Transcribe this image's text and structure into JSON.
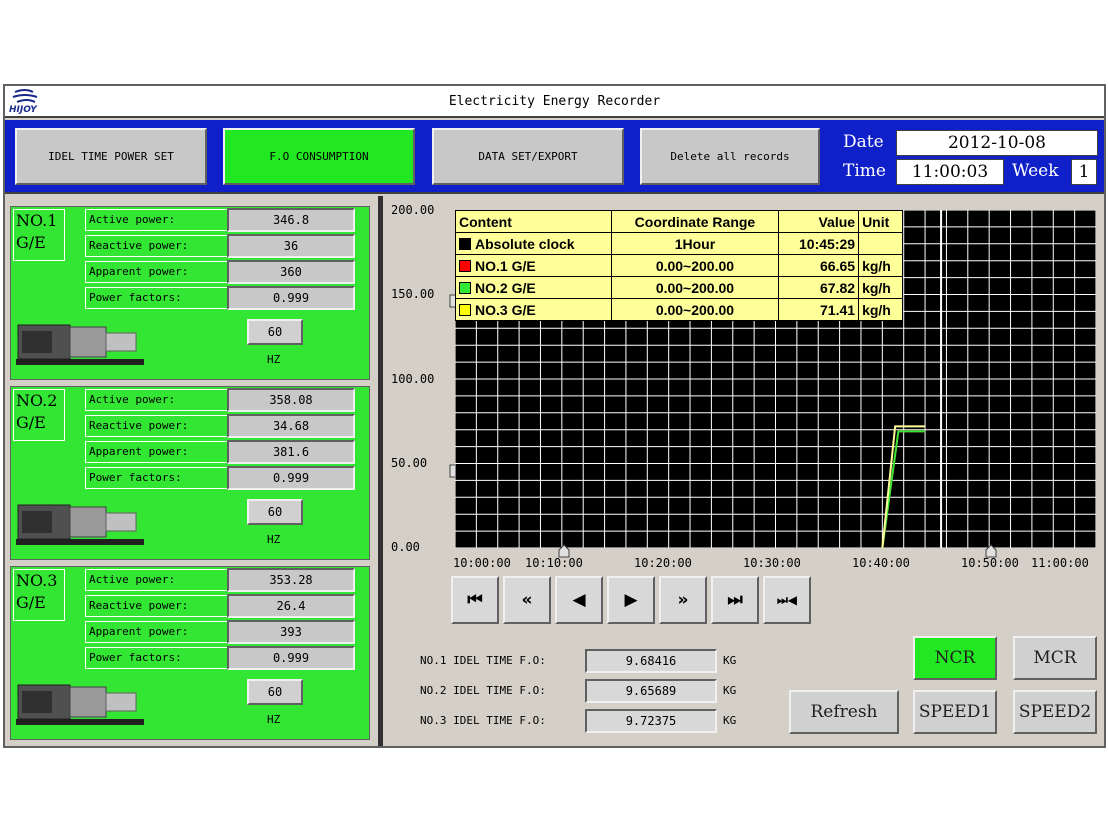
{
  "window": {
    "title": "Electricity Energy Recorder",
    "logo_text": "HIJOY"
  },
  "toolbar": {
    "idle_time_power_set": "IDEL TIME POWER SET",
    "fo_consumption": "F.O CONSUMPTION",
    "data_set_export": "DATA SET/EXPORT",
    "delete_all": "Delete all records"
  },
  "datetime": {
    "date_label": "Date",
    "date": "2012-10-08",
    "time_label": "Time",
    "time": "11:00:03",
    "week_label": "Week",
    "week": "1"
  },
  "generators": [
    {
      "name_line1": "NO.1",
      "name_line2": "G/E",
      "active_label": "Active power:",
      "active": "346.8",
      "reactive_label": "Reactive power:",
      "reactive": "36",
      "apparent_label": "Apparent power:",
      "apparent": "360",
      "pf_label": "Power factors:",
      "pf": "0.999",
      "hz": "60",
      "hz_unit": "HZ"
    },
    {
      "name_line1": "NO.2",
      "name_line2": "G/E",
      "active_label": "Active power:",
      "active": "358.08",
      "reactive_label": "Reactive power:",
      "reactive": "34.68",
      "apparent_label": "Apparent power:",
      "apparent": "381.6",
      "pf_label": "Power factors:",
      "pf": "0.999",
      "hz": "60",
      "hz_unit": "HZ"
    },
    {
      "name_line1": "NO.3",
      "name_line2": "G/E",
      "active_label": "Active power:",
      "active": "353.28",
      "reactive_label": "Reactive power:",
      "reactive": "26.4",
      "apparent_label": "Apparent power:",
      "apparent": "393",
      "pf_label": "Power factors:",
      "pf": "0.999",
      "hz": "60",
      "hz_unit": "HZ"
    }
  ],
  "legend": {
    "headers": [
      "Content",
      "Coordinate Range",
      "Value",
      "Unit"
    ],
    "rows": [
      {
        "content": "Absolute clock",
        "range": "1Hour",
        "value": "10:45:29",
        "unit": "",
        "color": "#000000"
      },
      {
        "content": "NO.1 G/E",
        "range": "0.00~200.00",
        "value": "66.65",
        "unit": "kg/h",
        "color": "#ff0000"
      },
      {
        "content": "NO.2 G/E",
        "range": "0.00~200.00",
        "value": "67.82",
        "unit": "kg/h",
        "color": "#33e633"
      },
      {
        "content": "NO.3 G/E",
        "range": "0.00~200.00",
        "value": "71.41",
        "unit": "kg/h",
        "color": "#ffff00"
      }
    ]
  },
  "chart_data": {
    "type": "line",
    "y_ticks": [
      "200.00",
      "150.00",
      "100.00",
      "50.00",
      "0.00"
    ],
    "x_ticks": [
      "10:00:00",
      "10:10:00",
      "10:20:00",
      "10:30:00",
      "10:40:00",
      "10:50:00",
      "11:00:00"
    ],
    "ylim": [
      0,
      200
    ],
    "xlim_minutes": [
      0,
      60
    ],
    "series": [
      {
        "name": "NO.1 G/E",
        "color": "#ff0000",
        "x_minutes": [
          40,
          41.5,
          44
        ],
        "y": [
          0,
          69,
          69
        ]
      },
      {
        "name": "NO.2 G/E",
        "color": "#33e633",
        "x_minutes": [
          40,
          41.5,
          44
        ],
        "y": [
          0,
          69,
          69
        ]
      },
      {
        "name": "NO.3 G/E",
        "color": "#ffff99",
        "x_minutes": [
          40,
          41.2,
          44
        ],
        "y": [
          0,
          72,
          72
        ]
      }
    ],
    "cursor_minutes": 45.5,
    "grid": true
  },
  "nav_buttons": [
    {
      "name": "first-button",
      "glyph": "⏮"
    },
    {
      "name": "fast-back-button",
      "glyph": "«"
    },
    {
      "name": "back-button",
      "glyph": "◀"
    },
    {
      "name": "forward-button",
      "glyph": "▶"
    },
    {
      "name": "fast-forward-button",
      "glyph": "»"
    },
    {
      "name": "last-button",
      "glyph": "⏭"
    },
    {
      "name": "center-button",
      "glyph": "⏭◀"
    }
  ],
  "idle": [
    {
      "label": "NO.1 IDEL TIME F.O:",
      "value": "9.68416",
      "unit": "KG"
    },
    {
      "label": "NO.2 IDEL TIME F.O:",
      "value": "9.65689",
      "unit": "KG"
    },
    {
      "label": "NO.3 IDEL TIME F.O:",
      "value": "9.72375",
      "unit": "KG"
    }
  ],
  "speed_buttons": {
    "ncr": "NCR",
    "mcr": "MCR",
    "refresh": "Refresh",
    "speed1": "SPEED1",
    "speed2": "SPEED2"
  }
}
